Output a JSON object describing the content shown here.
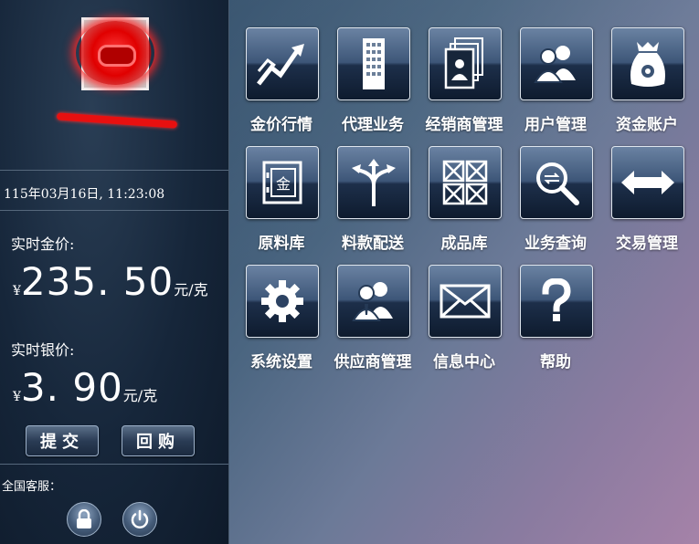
{
  "left_panel": {
    "datetime": "115年03月16日, 11:23:08",
    "gold": {
      "label": "实时金价:",
      "currency": "¥",
      "value": "235. 50",
      "unit": "元/克"
    },
    "silver": {
      "label": "实时银价:",
      "currency": "¥",
      "value": "3. 90",
      "unit": "元/克"
    },
    "buttons": {
      "submit": "提交",
      "buyback": "回购"
    },
    "service_label": "全国客服："
  },
  "menu": [
    {
      "label": "金价行情",
      "icon": "chart-trend-icon"
    },
    {
      "label": "代理业务",
      "icon": "building-icon"
    },
    {
      "label": "经销商管理",
      "icon": "documents-person-icon"
    },
    {
      "label": "用户管理",
      "icon": "users-icon"
    },
    {
      "label": "资金账户",
      "icon": "money-bag-icon"
    },
    {
      "label": "原料库",
      "icon": "safe-icon"
    },
    {
      "label": "料款配送",
      "icon": "split-arrows-icon"
    },
    {
      "label": "成品库",
      "icon": "boxes-icon"
    },
    {
      "label": "业务查询",
      "icon": "magnifier-icon"
    },
    {
      "label": "交易管理",
      "icon": "exchange-arrows-icon"
    },
    {
      "label": "系统设置",
      "icon": "gear-icon"
    },
    {
      "label": "供应商管理",
      "icon": "supplier-people-icon"
    },
    {
      "label": "信息中心",
      "icon": "envelope-icon"
    },
    {
      "label": "帮助",
      "icon": "question-icon"
    }
  ]
}
